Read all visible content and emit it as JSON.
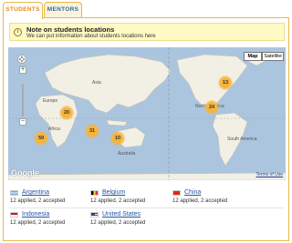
{
  "tabs": [
    {
      "label": "STUDENTS"
    },
    {
      "label": "MENTORS"
    }
  ],
  "note": {
    "title": "Note on students locations",
    "text": "We can put information about students locations here"
  },
  "map": {
    "type_buttons": {
      "map": "Map",
      "satellite": "Satellite"
    },
    "zoom_in": "+",
    "zoom_out": "−",
    "google_label": "Google",
    "terms_label": "Terms of Use",
    "clusters": [
      {
        "count": "20"
      },
      {
        "count": "31"
      },
      {
        "count": "59"
      },
      {
        "count": "10"
      },
      {
        "count": "13"
      },
      {
        "count": "24"
      }
    ],
    "labels": {
      "asia": "Asia",
      "europe": "Europe",
      "africa": "Africa",
      "australia": "Australia",
      "north_america": "North America",
      "south_america": "South America"
    }
  },
  "countries": [
    {
      "name": "Argentina",
      "applied": "12",
      "accepted": "2",
      "stats": "12 applied, 2 accepted",
      "flag": "argentina-flag-icon"
    },
    {
      "name": "Belgium",
      "applied": "12",
      "accepted": "2",
      "stats": "12 applied, 2 accepted",
      "flag": "belgium-flag-icon"
    },
    {
      "name": "China",
      "applied": "12",
      "accepted": "2",
      "stats": "12 applied, 2 accepted",
      "flag": "china-flag-icon"
    },
    {
      "name": "Indonesia",
      "applied": "12",
      "accepted": "2",
      "stats": "12 applied, 2 accepted",
      "flag": "indonesia-flag-icon"
    },
    {
      "name": "United States",
      "applied": "12",
      "accepted": "2",
      "stats": "12 applied, 2 accepted",
      "flag": "us-flag-icon"
    }
  ],
  "colors": {
    "accent": "#e28a16",
    "tab_border": "#e8b84a",
    "link": "#2456a6",
    "note_bg": "#fff9c4",
    "ocean": "#abc5de",
    "land": "#f2efe5",
    "cluster": "#f6b43a"
  }
}
